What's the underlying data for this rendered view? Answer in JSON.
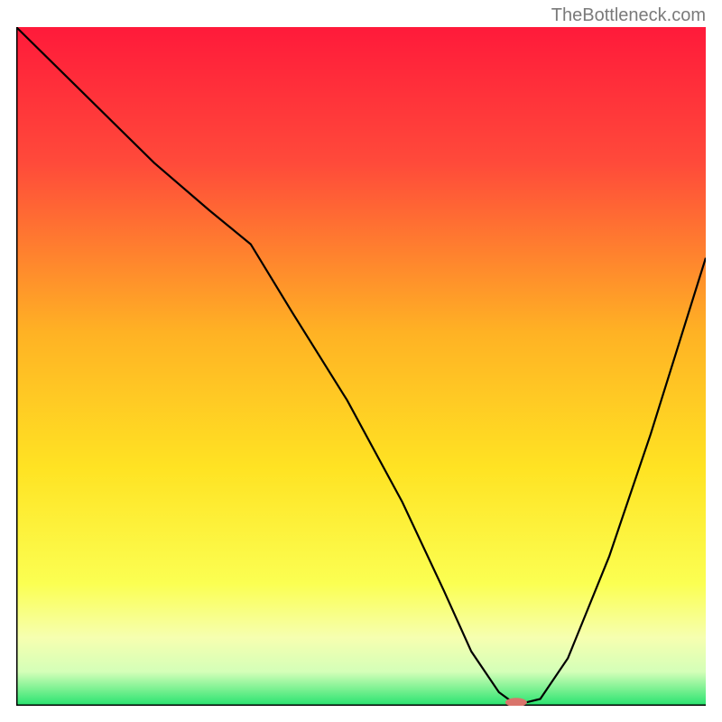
{
  "watermark": "TheBottleneck.com",
  "chart_data": {
    "type": "line",
    "title": "",
    "xlabel": "",
    "ylabel": "",
    "xlim": [
      0,
      100
    ],
    "ylim": [
      0,
      100
    ],
    "gradient_stops": [
      {
        "offset": 0.0,
        "color": "#ff1a3a"
      },
      {
        "offset": 0.2,
        "color": "#ff4a3a"
      },
      {
        "offset": 0.45,
        "color": "#ffb224"
      },
      {
        "offset": 0.65,
        "color": "#ffe323"
      },
      {
        "offset": 0.82,
        "color": "#fbff52"
      },
      {
        "offset": 0.9,
        "color": "#f6ffb0"
      },
      {
        "offset": 0.95,
        "color": "#d4ffb8"
      },
      {
        "offset": 1.0,
        "color": "#26e36e"
      }
    ],
    "curve": {
      "x": [
        0,
        10,
        20,
        28,
        34,
        40,
        48,
        56,
        62,
        66,
        70,
        72,
        74,
        76,
        80,
        86,
        92,
        100
      ],
      "y": [
        100,
        90,
        80,
        73,
        68,
        58,
        45,
        30,
        17,
        8,
        2,
        0.5,
        0.5,
        1,
        7,
        22,
        40,
        66
      ]
    },
    "marker": {
      "x": 72.5,
      "y": 0.5,
      "color": "#d9746b",
      "rx": 12,
      "ry": 5
    },
    "axis_color": "#000000",
    "curve_color": "#000000"
  }
}
